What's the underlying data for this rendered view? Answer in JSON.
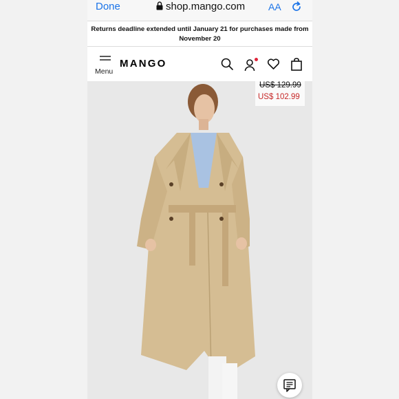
{
  "browser": {
    "done_label": "Done",
    "url": "shop.mango.com",
    "text_size_label": "AA",
    "lock_icon": "lock-icon",
    "reload_icon": "reload-icon"
  },
  "notice": {
    "text": "Returns deadline extended until January 21 for purchases made from November 20"
  },
  "header": {
    "menu_label": "Menu",
    "logo": "MANGO",
    "icons": [
      "search-icon",
      "account-icon",
      "wishlist-heart-icon",
      "shopping-bag-icon"
    ]
  },
  "product": {
    "old_price": "US$ 129.99",
    "new_price": "US$ 102.99",
    "colors": {
      "sale": "#c62828",
      "link": "#1a73e8",
      "notification": "#e0243a"
    }
  },
  "chat": {
    "icon": "chat-icon"
  }
}
